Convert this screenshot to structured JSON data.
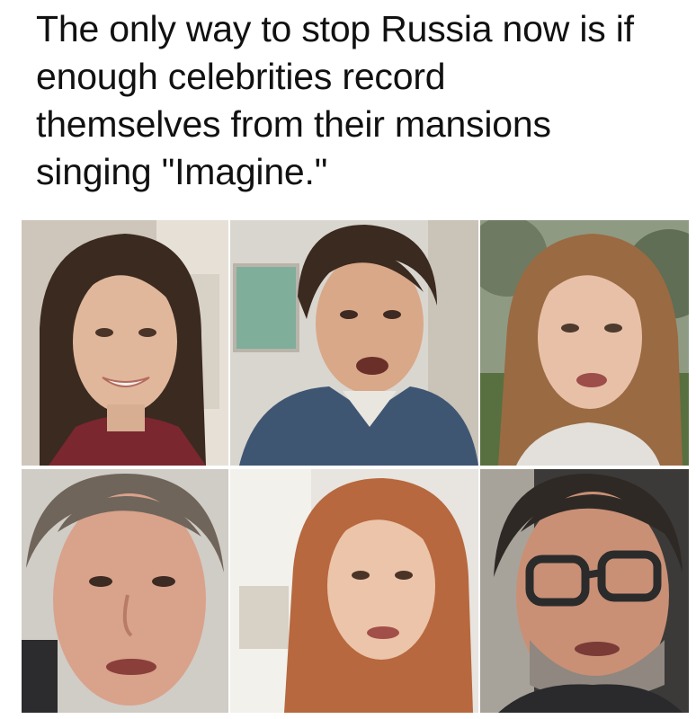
{
  "caption": {
    "text": "The only way to stop Russia now is if\nenough celebrities record\nthemselves from their mansions\nsinging \"Imagine.\""
  },
  "photo_grid": {
    "tiles": [
      {
        "description_icon": "person-photo-icon"
      },
      {
        "description_icon": "person-photo-icon"
      },
      {
        "description_icon": "person-photo-icon"
      },
      {
        "description_icon": "person-photo-icon"
      },
      {
        "description_icon": "person-photo-icon"
      },
      {
        "description_icon": "person-photo-icon"
      }
    ]
  },
  "colors": {
    "background": "#ffffff",
    "text": "#111111"
  }
}
